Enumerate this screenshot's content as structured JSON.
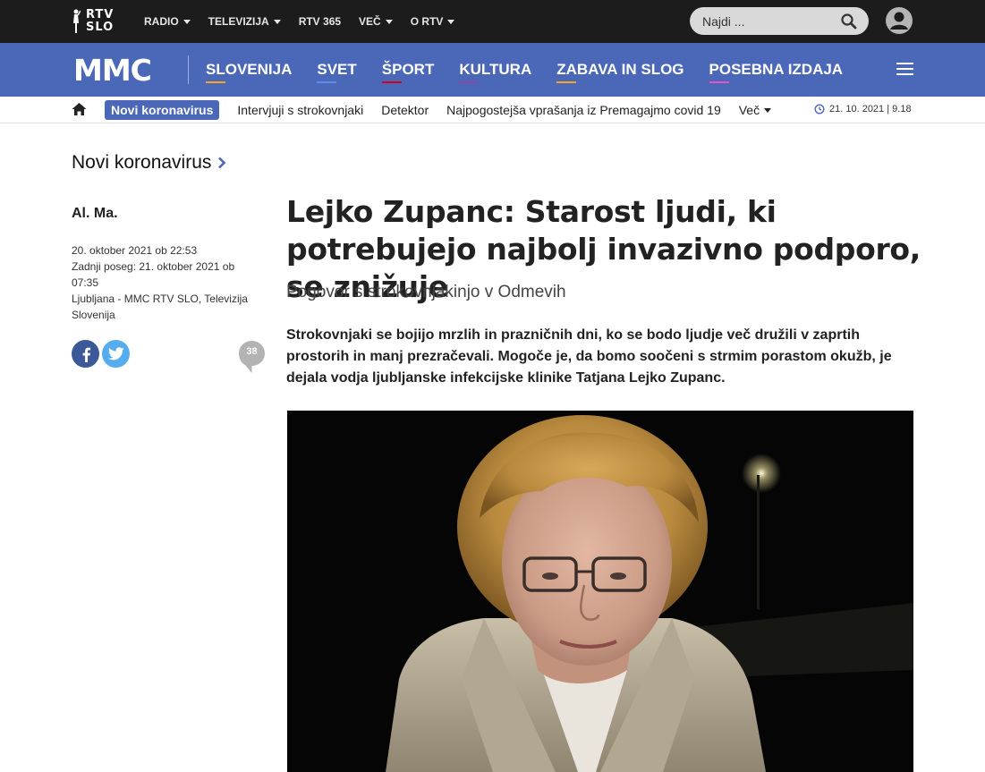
{
  "topbar": {
    "logo_line1": "RTV",
    "logo_line2": "SLO",
    "nav": [
      {
        "label": "RADIO",
        "has_dropdown": true
      },
      {
        "label": "TELEVIZIJA",
        "has_dropdown": true
      },
      {
        "label": "RTV 365",
        "has_dropdown": false
      },
      {
        "label": "VEČ",
        "has_dropdown": true
      },
      {
        "label": "O RTV",
        "has_dropdown": true
      }
    ],
    "search_placeholder": "Najdi ..."
  },
  "mmcbar": {
    "logo": "MMC",
    "nav": [
      {
        "label": "SLOVENIJA",
        "accent": "#f5a623"
      },
      {
        "label": "SVET",
        "accent": "#5b8def"
      },
      {
        "label": "ŠPORT",
        "accent": "#d0021b"
      },
      {
        "label": "KULTURA",
        "accent": "#8e44ad"
      },
      {
        "label": "ZABAVA IN SLOG",
        "accent": "#f5a623"
      },
      {
        "label": "POSEBNA IZDAJA",
        "accent": "#e056c8"
      }
    ]
  },
  "subnav": {
    "active": "Novi koronavirus",
    "links": [
      "Intervjuji s strokovnjaki",
      "Detektor",
      "Najpogostejša vprašanja iz Premagajmo covid 19"
    ],
    "more": "Več",
    "date": "21. 10. 2021",
    "time": "9.18"
  },
  "article": {
    "section": "Novi koronavirus",
    "author": "Al. Ma.",
    "published": "20. oktober 2021 ob 22:53",
    "updated": "Zadnji poseg: 21. oktober 2021 ob 07:35",
    "location": "Ljubljana - MMC RTV SLO, Televizija Slovenija",
    "comments": "38",
    "headline": "Lejko Zupanc: Starost ljudi, ki potrebujejo najbolj invazivno podporo, se znižuje",
    "subtitle": "Pogovor s strokovnjakinjo v Odmevih",
    "lead": "Strokovnjaki se bojijo mrzlih in prazničnih dni, ko se bodo ljudje več družili v zaprtih prostorih in manj prezračevali. Mogoče je, da bomo soočeni s strmim porastom okužb, je dejala vodja ljubljanske infekcijske klinike Tatjana Lejko Zupanc."
  },
  "colors": {
    "topbar": "#1c1c1c",
    "brand_blue": "#4b68b8"
  }
}
